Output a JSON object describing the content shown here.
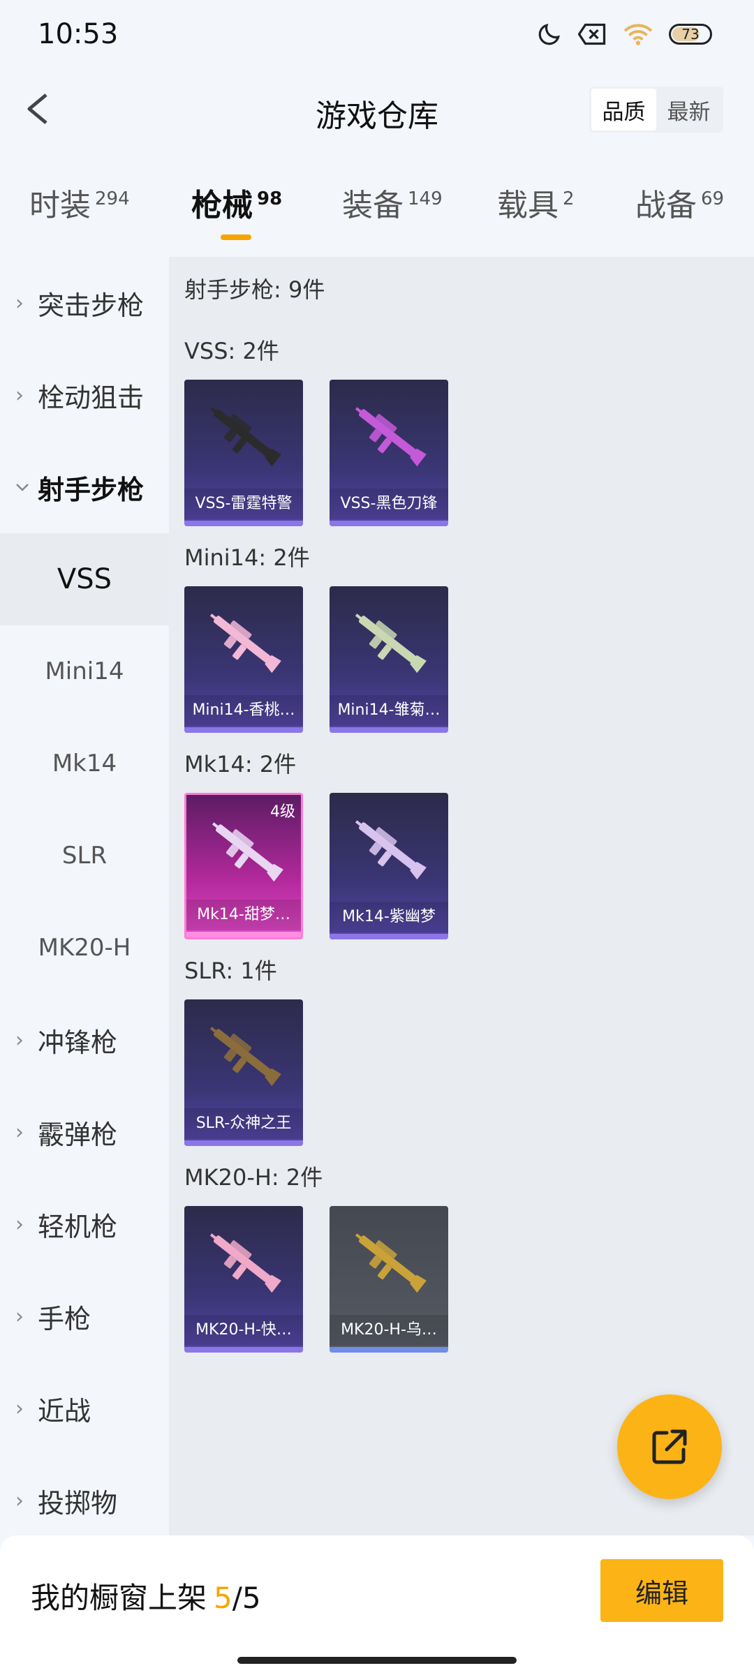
{
  "status_bar": {
    "time": "10:53",
    "battery": "73",
    "icons": [
      "moon-icon",
      "notification-x-icon",
      "wifi-icon",
      "battery-icon"
    ]
  },
  "header": {
    "title": "游戏仓库",
    "sort_options": [
      "品质",
      "最新"
    ],
    "sort_selected": "品质"
  },
  "tabs": [
    {
      "label": "时装",
      "count": "294"
    },
    {
      "label": "枪械",
      "count": "98",
      "active": true
    },
    {
      "label": "装备",
      "count": "149"
    },
    {
      "label": "载具",
      "count": "2"
    },
    {
      "label": "战备",
      "count": "69"
    }
  ],
  "sidebar": {
    "categories": [
      {
        "label": "突击步枪"
      },
      {
        "label": "栓动狙击"
      },
      {
        "label": "射手步枪",
        "expanded": true
      },
      {
        "label": "冲锋枪"
      },
      {
        "label": "霰弹枪"
      },
      {
        "label": "轻机枪"
      },
      {
        "label": "手枪"
      },
      {
        "label": "近战"
      },
      {
        "label": "投掷物"
      }
    ],
    "subitems": [
      {
        "label": "VSS",
        "selected": true
      },
      {
        "label": "Mini14"
      },
      {
        "label": "Mk14"
      },
      {
        "label": "SLR"
      },
      {
        "label": "MK20-H"
      }
    ]
  },
  "main": {
    "category_summary": "射手步枪: 9件",
    "sections": [
      {
        "title": "VSS: 2件",
        "items": [
          {
            "name": "VSS-雷霆特警",
            "gun_color": "#2b2b2b"
          },
          {
            "name": "VSS-黑色刀锋",
            "gun_color": "#c45ad8"
          }
        ]
      },
      {
        "title": "Mini14: 2件",
        "items": [
          {
            "name": "Mini14-香桃…",
            "gun_color": "#f2b8d6"
          },
          {
            "name": "Mini14-雏菊…",
            "gun_color": "#c9d8b2"
          }
        ]
      },
      {
        "title": "Mk14: 2件",
        "items": [
          {
            "name": "Mk14-甜梦…",
            "level": "4级",
            "gun_color": "#e8d6f2",
            "style": "pink"
          },
          {
            "name": "Mk14-紫幽梦",
            "gun_color": "#d8c2ee"
          }
        ]
      },
      {
        "title": "SLR: 1件",
        "items": [
          {
            "name": "SLR-众神之王",
            "gun_color": "#8a6d3b"
          }
        ]
      },
      {
        "title": "MK20-H: 2件",
        "items": [
          {
            "name": "MK20-H-快…",
            "gun_color": "#f0a9c8"
          },
          {
            "name": "MK20-H-乌…",
            "gun_color": "#c9a23a",
            "style": "grey"
          }
        ]
      }
    ]
  },
  "bottom": {
    "showcase_label": "我的橱窗上架",
    "showcase_current": "5",
    "showcase_total": "/5",
    "edit_label": "编辑"
  },
  "colors": {
    "accent": "#fcb316",
    "tab_underline": "#f7a500"
  }
}
